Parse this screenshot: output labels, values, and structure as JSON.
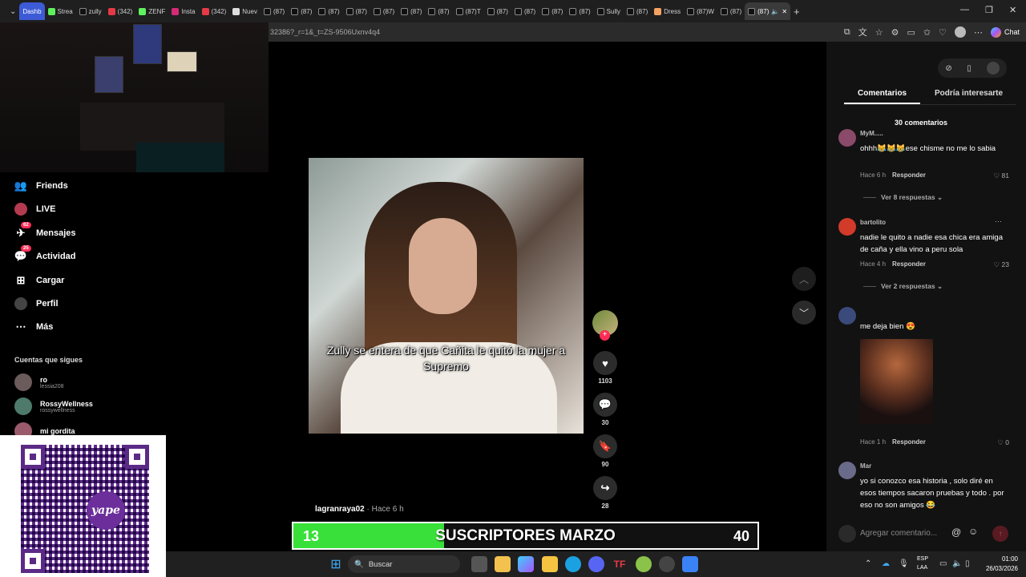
{
  "browser": {
    "tabs": [
      "Dashb",
      "Strea",
      "zully",
      "(342)",
      "ZENF",
      "Insta",
      "(342)",
      "Nuev",
      "(87)",
      "(87)",
      "(87)",
      "(87)",
      "(87)",
      "(87)",
      "(87)",
      "(87)T",
      "(87)",
      "(87)",
      "(87)",
      "(87)",
      "Sully",
      "(87)",
      "Dress",
      "(87)W",
      "(87)",
      "(87)"
    ],
    "url": "32386?_r=1&_t=ZS-9506Uxnv4q4",
    "chat_label": "Chat"
  },
  "nav": {
    "items": [
      {
        "label": "Friends",
        "icon": "friends-icon"
      },
      {
        "label": "LIVE",
        "icon": "live-icon"
      },
      {
        "label": "Mensajes",
        "icon": "messages-icon",
        "badge": "62"
      },
      {
        "label": "Actividad",
        "icon": "activity-icon",
        "badge": "25"
      },
      {
        "label": "Cargar",
        "icon": "upload-icon"
      },
      {
        "label": "Perfil",
        "icon": "profile-icon"
      },
      {
        "label": "Más",
        "icon": "more-icon"
      }
    ],
    "following_header": "Cuentas que sigues",
    "following": [
      {
        "name": "ro",
        "handle": "lessia208"
      },
      {
        "name": "RossyWellness",
        "handle": "rossywellness"
      },
      {
        "name": "mi gordita",
        "handle": ""
      }
    ]
  },
  "qr": {
    "logo_text": "yape"
  },
  "video": {
    "caption": "Zully se entera de que Cañita le quitó la mujer a Supremo",
    "author": "lagranraya02",
    "time": "· Hace 6 h",
    "likes": "1103",
    "comments": "30",
    "saves": "90",
    "shares": "28"
  },
  "subs_bar": {
    "current": "13",
    "title": "SUSCRIPTORES MARZO",
    "goal": "40",
    "progress": 0.325,
    "fill_color": "#39e039"
  },
  "comments_panel": {
    "tabs": [
      "Comentarios",
      "Podría interesarte"
    ],
    "count_label": "30 comentarios",
    "comments": [
      {
        "user": "MyM.....",
        "text": "ohhh😹😹😹ese chisme no me lo sabia",
        "time": "Hace 6 h",
        "reply": "Responder",
        "likes": "81",
        "replies": "Ver 8 respuestas"
      },
      {
        "user": "bartolito",
        "text": "nadie le quito a nadie esa chica era amiga de caña y ella vino a peru sola",
        "time": "Hace 4 h",
        "reply": "Responder",
        "likes": "23",
        "replies": "Ver 2 respuestas"
      },
      {
        "user": "",
        "text": "me deja bien 😍",
        "time": "Hace 1 h",
        "reply": "Responder",
        "likes": "0",
        "replies": ""
      },
      {
        "user": "Mar",
        "text": "yo si conozco esa historia , solo diré en esos tiempos sacaron pruebas y todo . por eso no son amigos 😂",
        "time": "",
        "reply": "",
        "likes": "",
        "replies": ""
      }
    ],
    "input_placeholder": "Agregar comentario..."
  },
  "taskbar": {
    "search_label": "Buscar",
    "lang": "ESP",
    "lang2": "LAA",
    "time": "01:00",
    "date": "26/03/2026"
  },
  "colors": {
    "accent": "#fe2c55",
    "panel": "#121212"
  }
}
